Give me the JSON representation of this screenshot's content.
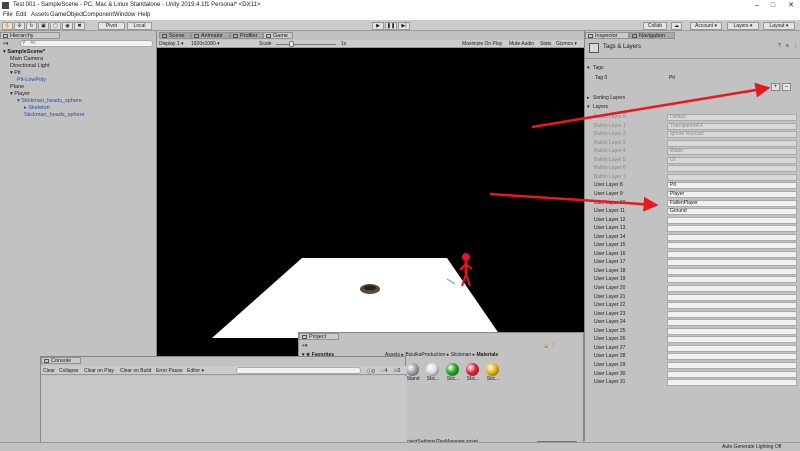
{
  "window": {
    "title": "Test 001 - SampleScene - PC, Mac & Linux Standalone - Unity 2019.4.1f1 Personal* <DX11>"
  },
  "menu": [
    "File",
    "Edit",
    "Assets",
    "GameObject",
    "Component",
    "Window",
    "Help"
  ],
  "toolbar": {
    "pivot": "Pivot",
    "local": "Local",
    "collab": "Collab",
    "account": "Account",
    "layers": "Layers",
    "layout": "Layout"
  },
  "hierarchy": {
    "tab": "Hierarchy",
    "search_placeholder": "All",
    "items": [
      {
        "label": "SampleScene*",
        "indent": 0
      },
      {
        "label": "Main Camera",
        "indent": 1
      },
      {
        "label": "Directional Light",
        "indent": 1
      },
      {
        "label": "Pit",
        "indent": 1
      },
      {
        "label": "Pit-LowPoly",
        "indent": 2
      },
      {
        "label": "Plane",
        "indent": 1
      },
      {
        "label": "Player",
        "indent": 1
      },
      {
        "label": "Stickman_heads_sphere",
        "indent": 2
      },
      {
        "label": "Skeleton",
        "indent": 3
      },
      {
        "label": "Stickman_heads_sphere",
        "indent": 3
      }
    ]
  },
  "center_tabs": [
    {
      "label": "Scene"
    },
    {
      "label": "Animator"
    },
    {
      "label": "Profiler"
    },
    {
      "label": "Game"
    }
  ],
  "game_bar": {
    "display": "Display 1",
    "resolution": "1920x1080",
    "scale_label": "Scale",
    "scale_value": "1x",
    "maximize": "Maximize On Play",
    "mute": "Mute Audio",
    "stats": "Stats",
    "gizmos": "Gizmos"
  },
  "inspector": {
    "tabs": [
      {
        "label": "Inspector"
      },
      {
        "label": "Navigation"
      }
    ],
    "title": "Tags & Layers",
    "tags_header": "Tags",
    "tag0_label": "Tag 0",
    "tag0_value": "Pit",
    "sorting_layers": "Sorting Layers",
    "layers_header": "Layers",
    "layers": [
      {
        "label": "Builtin Layer 0",
        "value": "Default",
        "builtin": true
      },
      {
        "label": "Builtin Layer 1",
        "value": "TransparentFX",
        "builtin": true
      },
      {
        "label": "Builtin Layer 2",
        "value": "Ignore Raycast",
        "builtin": true
      },
      {
        "label": "Builtin Layer 3",
        "value": "",
        "builtin": true
      },
      {
        "label": "Builtin Layer 4",
        "value": "Water",
        "builtin": true
      },
      {
        "label": "Builtin Layer 5",
        "value": "UI",
        "builtin": true
      },
      {
        "label": "Builtin Layer 6",
        "value": "",
        "builtin": true
      },
      {
        "label": "Builtin Layer 7",
        "value": "",
        "builtin": true
      },
      {
        "label": "User Layer 8",
        "value": "Pit",
        "builtin": false
      },
      {
        "label": "User Layer 9",
        "value": "Player",
        "builtin": false
      },
      {
        "label": "User Layer 10",
        "value": "FallenPlayer",
        "builtin": false
      },
      {
        "label": "User Layer 11",
        "value": "Ground",
        "builtin": false
      },
      {
        "label": "User Layer 12",
        "value": "",
        "builtin": false
      },
      {
        "label": "User Layer 13",
        "value": "",
        "builtin": false
      },
      {
        "label": "User Layer 14",
        "value": "",
        "builtin": false
      },
      {
        "label": "User Layer 15",
        "value": "",
        "builtin": false
      },
      {
        "label": "User Layer 16",
        "value": "",
        "builtin": false
      },
      {
        "label": "User Layer 17",
        "value": "",
        "builtin": false
      },
      {
        "label": "User Layer 18",
        "value": "",
        "builtin": false
      },
      {
        "label": "User Layer 19",
        "value": "",
        "builtin": false
      },
      {
        "label": "User Layer 20",
        "value": "",
        "builtin": false
      },
      {
        "label": "User Layer 21",
        "value": "",
        "builtin": false
      },
      {
        "label": "User Layer 22",
        "value": "",
        "builtin": false
      },
      {
        "label": "User Layer 23",
        "value": "",
        "builtin": false
      },
      {
        "label": "User Layer 24",
        "value": "",
        "builtin": false
      },
      {
        "label": "User Layer 25",
        "value": "",
        "builtin": false
      },
      {
        "label": "User Layer 26",
        "value": "",
        "builtin": false
      },
      {
        "label": "User Layer 27",
        "value": "",
        "builtin": false
      },
      {
        "label": "User Layer 28",
        "value": "",
        "builtin": false
      },
      {
        "label": "User Layer 29",
        "value": "",
        "builtin": false
      },
      {
        "label": "User Layer 30",
        "value": "",
        "builtin": false
      },
      {
        "label": "User Layer 31",
        "value": "",
        "builtin": false
      }
    ]
  },
  "project": {
    "tab": "Project",
    "favorites": "Favorites",
    "breadcrumb": [
      "Assets",
      "BizulkaProduction",
      "Stickman",
      "Materials"
    ],
    "assets": [
      {
        "label": "Stand",
        "color": "#9aa3ad"
      },
      {
        "label": "Stic...",
        "color": "#d8dde3"
      },
      {
        "label": "Stic...",
        "color": "#1fa51f"
      },
      {
        "label": "Stic...",
        "color": "#e0202e"
      },
      {
        "label": "Stic...",
        "color": "#f0b300"
      }
    ],
    "path": "ProjectSettings/TagManager.asset"
  },
  "console": {
    "tab": "Console",
    "buttons": [
      "Clear",
      "Collapse",
      "Clear on Play",
      "Clear on Build",
      "Error Pause",
      "Editor ▾"
    ],
    "counts": [
      "0",
      "4",
      "0"
    ]
  },
  "status_bar": {
    "text": "Auto Generate Lighting Off"
  },
  "colors": {
    "annotation_arrow": "#e8181e",
    "player": "#e01622"
  }
}
